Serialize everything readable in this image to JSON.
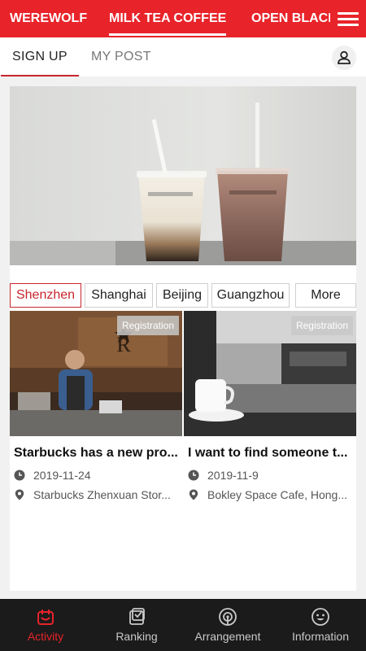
{
  "top_tabs": {
    "items": [
      {
        "label": "WEREWOLF"
      },
      {
        "label": "MILK TEA COFFEE"
      },
      {
        "label": "OPEN BLACK"
      }
    ],
    "active_index": 1,
    "menu_icon": "menu-icon"
  },
  "sub_tabs": {
    "items": [
      {
        "label": "SIGN UP"
      },
      {
        "label": "MY POST"
      }
    ],
    "active_index": 0,
    "user_icon": "user-icon"
  },
  "cities": {
    "items": [
      {
        "label": "Shenzhen"
      },
      {
        "label": "Shanghai"
      },
      {
        "label": "Beijing"
      },
      {
        "label": "Guangzhou"
      },
      {
        "label": "More"
      }
    ],
    "active_index": 0
  },
  "events": [
    {
      "badge": "Registration",
      "title": "Starbucks has a new pro...",
      "date": "2019-11-24",
      "location": "Starbucks Zhenxuan Stor..."
    },
    {
      "badge": "Registration",
      "title": "I want to find someone t...",
      "date": "2019-11-9",
      "location": "Bokley Space Cafe, Hong..."
    }
  ],
  "bottom_nav": {
    "items": [
      {
        "label": "Activity",
        "icon": "activity-icon"
      },
      {
        "label": "Ranking",
        "icon": "ranking-icon"
      },
      {
        "label": "Arrangement",
        "icon": "arrangement-icon"
      },
      {
        "label": "Information",
        "icon": "information-icon"
      }
    ],
    "active_index": 0
  },
  "colors": {
    "accent": "#e8232a",
    "bottom_bar": "#1b1b1b"
  }
}
